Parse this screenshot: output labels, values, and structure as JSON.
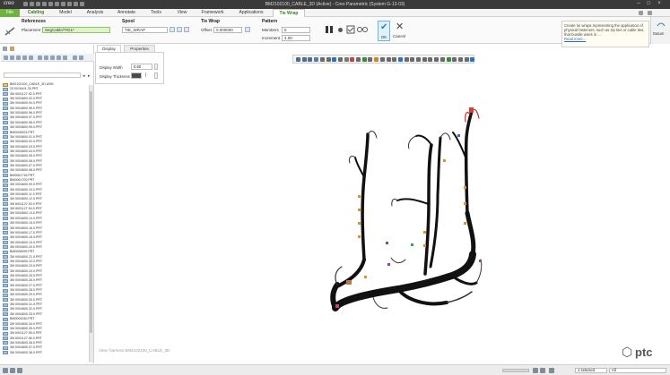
{
  "app": {
    "logo": "creo",
    "title": "BM2102100_CABLE_3D (Active) - Creo Parametric (System G-13-03)"
  },
  "tabs": [
    "File",
    "Cabling",
    "Model",
    "Analysis",
    "Annotate",
    "Tools",
    "View",
    "Framework",
    "Applications",
    "Tie Wrap"
  ],
  "ribbon": {
    "references": {
      "title": "References",
      "placement_label": "Placement",
      "placement_value": "SegCable/TIG1*"
    },
    "spool": {
      "title": "Spool",
      "value": "TIE_WRAP"
    },
    "tie_wrap": {
      "title": "Tie Wrap",
      "offset_label": "Offset",
      "offset_value": "0.000000"
    },
    "pattern": {
      "title": "Pattern",
      "members_label": "Members",
      "members_value": "5",
      "increment_label": "Increment",
      "increment_value": "4.00"
    },
    "ok_label": "OK",
    "cancel_label": "Cancel",
    "dataview_label": "Datum",
    "tooltip_text": "Create tie wraps representing the application of physical fasteners, such as zip ties or cable ties, that bundle wires in ...",
    "tooltip_more": "Read more..."
  },
  "panel_tabs": {
    "display": "Display",
    "properties": "Properties"
  },
  "display_panel": {
    "width_label": "Display Width",
    "width_value": "0.60",
    "thickness_label": "Display Thickness"
  },
  "tree": {
    "items": [
      "BM2102100_CABLE_3D.ASM",
      "20 0015411.30.PRT",
      "3M 6001127.92.0.PRT",
      "3M 0004600.92.0.PRT",
      "3M 0004600.94.0.PRT",
      "3M 0004600.95.0.PRT",
      "3M 0004600.96.0.PRT",
      "3M 0004600.97.0.PRT",
      "3M 0004600.98.0.PRT",
      "3M 0004600.99.0.PRT",
      "BM0006003.PRT",
      "3M 0004600.01.0.PRT",
      "3M 0004600.02.0.PRT",
      "3M 0004600.03.0.PRT",
      "3M 0004600.04.0.PRT",
      "3M 0004600.05.0.PRT",
      "3M 0004600.06.0.PRT",
      "3M 0004600.07.0.PRT",
      "3M 0004600.08.0.PRT",
      "BM0061716.PRT",
      "BM0061700.PRT",
      "3M 0004600.09.0.PRT",
      "3M 0004600.10.0.PRT",
      "3M 0004600.11.0.PRT",
      "3M 0004600.12.0.PRT",
      "3M 6001127.93.0.PRT",
      "3M 6001127.94.0.PRT",
      "3M 0004600.13.0.PRT",
      "3M 0004600.14.0.PRT",
      "3M 0004600.15.0.PRT",
      "3M 0004600.16.0.PRT",
      "3M 0004600.17.0.PRT",
      "3M 0004600.18.0.PRT",
      "3M 0004600.19.0.PRT",
      "3M 0004600.20.0.PRT",
      "BM0006099.PRT",
      "3M 0004600.21.0.PRT",
      "3M 0004600.22.0.PRT",
      "3M 0004600.23.0.PRT",
      "3M 0004600.24.0.PRT",
      "3M 0004600.25.0.PRT",
      "3M 0004600.26.0.PRT",
      "3M 0004600.27.0.PRT",
      "3M 0004600.28.0.PRT",
      "3M 0004600.29.0.PRT",
      "3M 0004600.30.0.PRT",
      "3M 0004600.31.0.PRT",
      "3M 0004600.32.0.PRT",
      "3M 0004600.33.0.PRT",
      "BM0004330.PRT",
      "3M 0004600.34.0.PRT",
      "3M 0004600.35.0.PRT",
      "3M 6001127.95.0.PRT",
      "3M 6001127.96.0.PRT",
      "3M 0004600.36.0.PRT",
      "3M 0004600.37.0.PRT",
      "3M 0004600.38.0.PRT"
    ]
  },
  "graphics": {
    "model_label": "View: harness BM2102100_CABLE_3D"
  },
  "brand": {
    "logo_text": "ptc",
    "logo_glyph": "⬡"
  },
  "status": {
    "selected": "1 selected",
    "filter": "All"
  },
  "colors": {
    "file_tab": "#6fb33f",
    "active_tab_text": "#3d7d1c",
    "ok_blue": "#2a7fc1",
    "harness_black": "#121212"
  }
}
